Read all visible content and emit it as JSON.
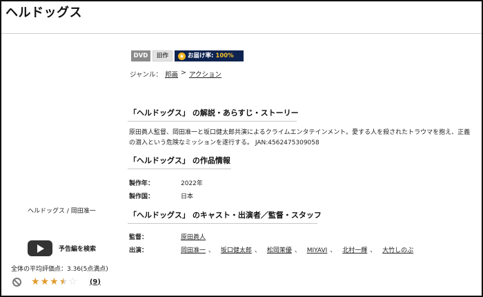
{
  "page": {
    "title": "ヘルドッグス"
  },
  "badges": {
    "format": "DVD",
    "age": "旧作",
    "delivery_label": "お届け率:",
    "delivery_rate": "100%"
  },
  "genre": {
    "label": "ジャンル：",
    "items": [
      "邦画",
      "アクション"
    ],
    "separator": ">"
  },
  "synopsis": {
    "heading": "「ヘルドッグス」 の解説・あらすじ・ストーリー",
    "line1": "原田眞人監督、岡田准一と坂口健太郎共演によるクライムエンタテインメント。愛する人を殺されたトラウマを抱え、正義",
    "line2": "の潜入という危険なミッションを遂行する。 JAN:4562475309058"
  },
  "info": {
    "heading": "「ヘルドッグス」 の作品情報",
    "year_label": "製作年：",
    "year": "2022年",
    "country_label": "製作国：",
    "country": "日本"
  },
  "cast": {
    "heading": "「ヘルドッグス」 のキャスト・出演者／監督・スタッフ",
    "director_label": "監督：",
    "director": "原田眞人",
    "cast_label": "出演：",
    "members": [
      "岡田准一",
      "坂口健太郎",
      "松岡茉優",
      "MIYAVI",
      "北村一輝",
      "大竹しのぶ"
    ],
    "separator": "、"
  },
  "product": {
    "name": "ヘルドッグス / 岡田准一",
    "trailer_label": "予告編を検索"
  },
  "rating": {
    "avg_label": "全体の平均評価点：",
    "avg_value": "3.36(5点満点)",
    "stars_value": 3.36,
    "stars_max": 5,
    "review_count": "(9)"
  },
  "icons": [
    "play-icon",
    "no-entry-icon",
    "star-icon",
    "medal-star-icon"
  ],
  "colors": {
    "delivery_bg": "#0e2350",
    "star": "#e09a2b",
    "dvd_badge": "#8b8b8b"
  }
}
